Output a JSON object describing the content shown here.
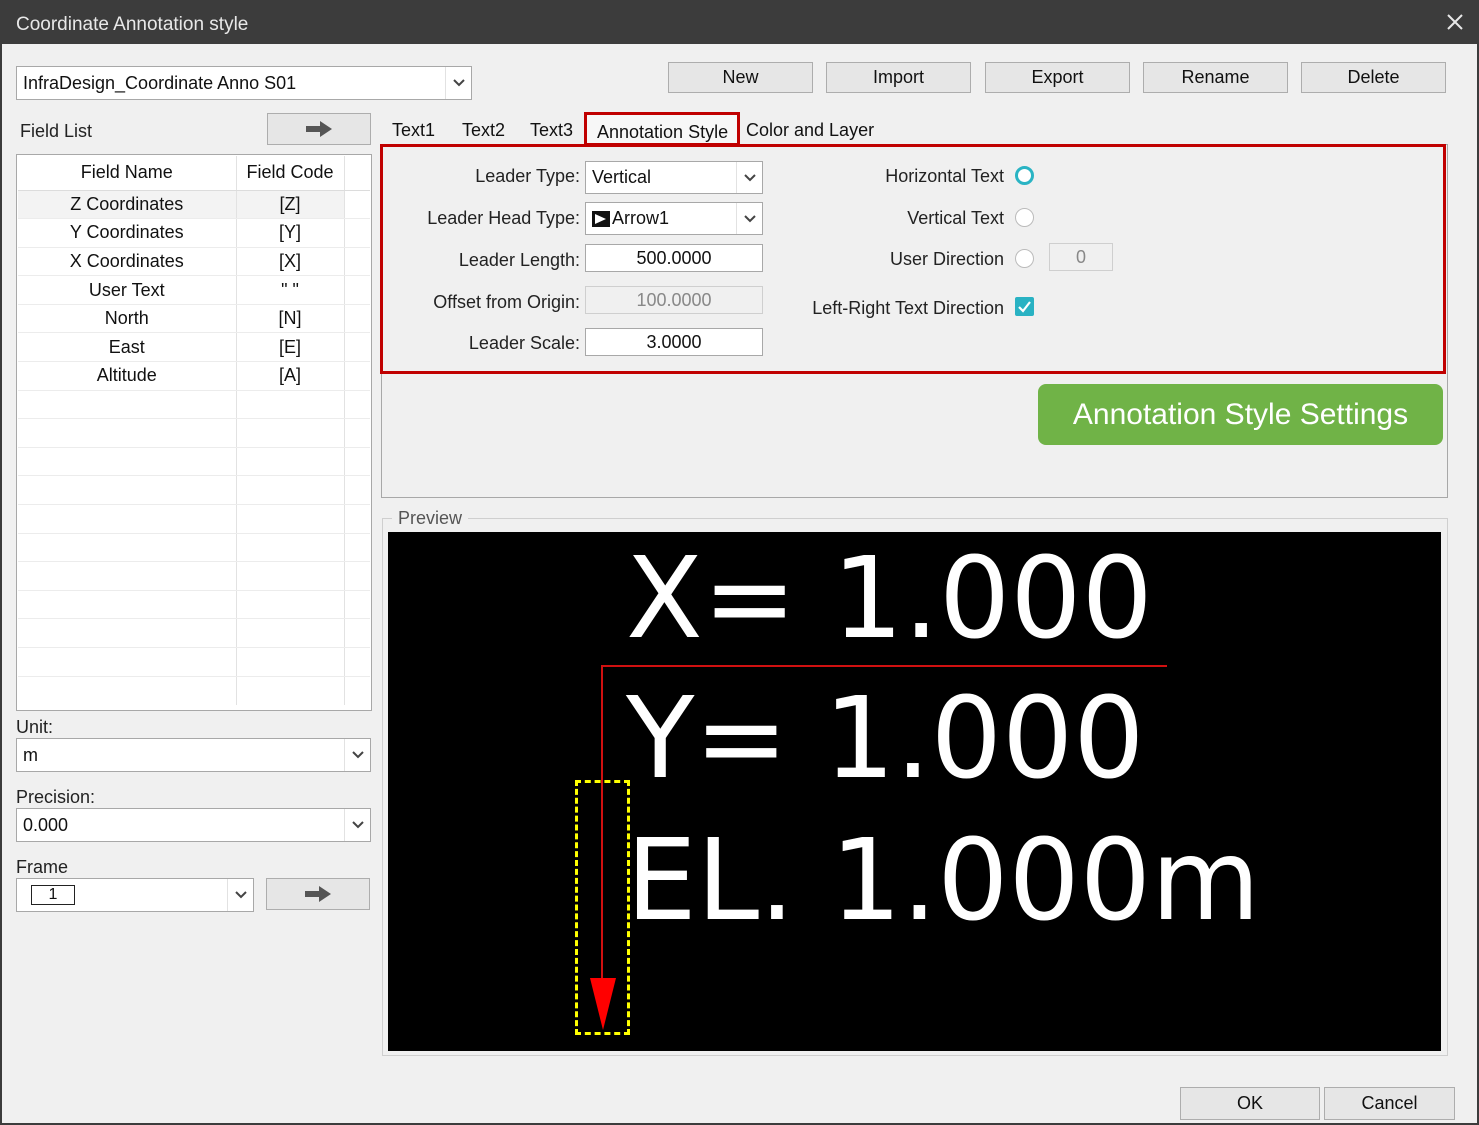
{
  "window": {
    "title": "Coordinate Annotation style"
  },
  "style_select": {
    "value": "InfraDesign_Coordinate Anno S01"
  },
  "toolbar": {
    "new": "New",
    "import": "Import",
    "export": "Export",
    "rename": "Rename",
    "delete": "Delete"
  },
  "field_list": {
    "label": "Field List",
    "headers": {
      "name": "Field Name",
      "code": "Field Code"
    },
    "rows": [
      {
        "name": "Z Coordinates",
        "code": "[Z]"
      },
      {
        "name": "Y Coordinates",
        "code": "[Y]"
      },
      {
        "name": "X Coordinates",
        "code": "[X]"
      },
      {
        "name": "User Text",
        "code": "\" \""
      },
      {
        "name": "North",
        "code": "[N]"
      },
      {
        "name": "East",
        "code": "[E]"
      },
      {
        "name": "Altitude",
        "code": "[A]"
      }
    ]
  },
  "unit": {
    "label": "Unit:",
    "value": "m"
  },
  "precision": {
    "label": "Precision:",
    "value": "0.000"
  },
  "frame": {
    "label": "Frame",
    "value": "1"
  },
  "tabs": [
    "Text1",
    "Text2",
    "Text3",
    "Annotation Style",
    "Color and Layer"
  ],
  "annotation": {
    "leader_type_label": "Leader Type:",
    "leader_type": "Vertical",
    "leader_head_label": "Leader Head Type:",
    "leader_head": "Arrow1",
    "leader_length_label": "Leader Length:",
    "leader_length": "500.0000",
    "offset_label": "Offset from Origin:",
    "offset": "100.0000",
    "leader_scale_label": "Leader Scale:",
    "leader_scale": "3.0000",
    "horizontal_text": "Horizontal Text",
    "vertical_text": "Vertical Text",
    "user_direction": "User Direction",
    "user_direction_value": "0",
    "lr_direction": "Left-Right Text Direction"
  },
  "callout": "Annotation Style Settings",
  "preview": {
    "label": "Preview",
    "line1": "X= 1.000",
    "line2": "Y= 1.000",
    "line3": "EL. 1.000m"
  },
  "footer": {
    "ok": "OK",
    "cancel": "Cancel"
  },
  "colors": {
    "highlight": "#c00000",
    "callout": "#70b347",
    "accent": "#29b2c3",
    "leader": "#ff0000"
  }
}
